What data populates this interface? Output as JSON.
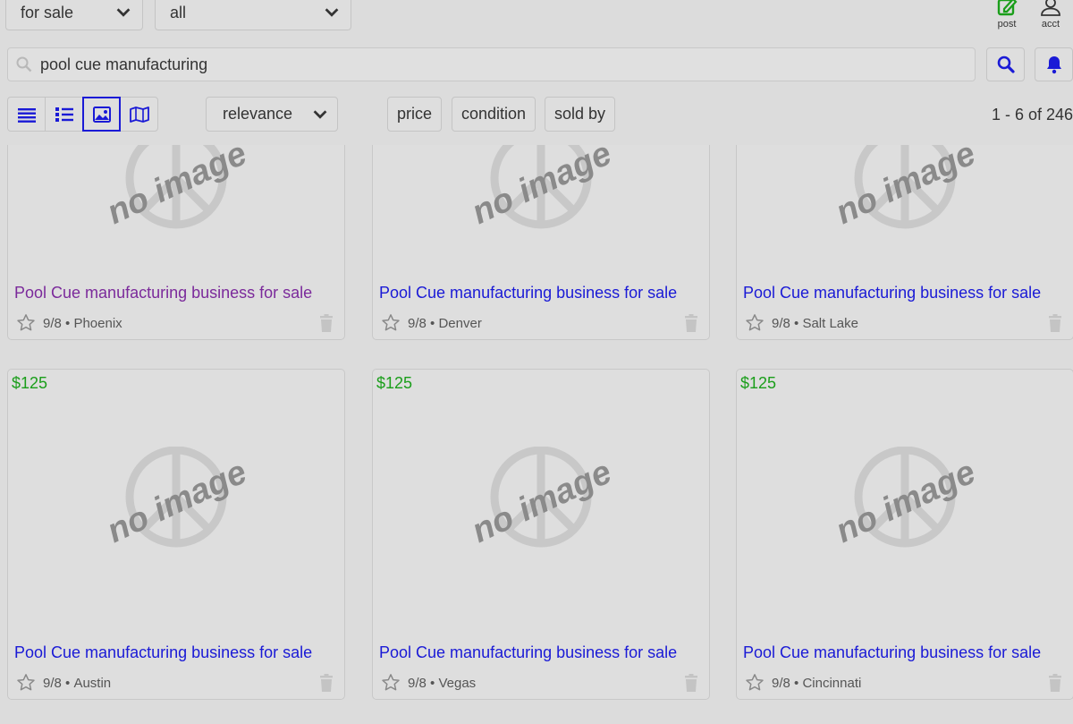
{
  "filters": {
    "category": "for sale",
    "scope": "all"
  },
  "actions": {
    "post": "post",
    "acct": "acct"
  },
  "search": {
    "query": "pool cue manufacturing"
  },
  "toolbar": {
    "sort": "relevance",
    "price": "price",
    "condition": "condition",
    "sold_by": "sold by",
    "result_count": "1 - 6 of 246"
  },
  "colors": {
    "link": "#1a1ad6",
    "visited": "#7b2a9b",
    "price": "#1a9e1a",
    "post_icon": "#1a9e1a"
  },
  "no_image_text": "no image",
  "listings": [
    {
      "price": "",
      "title": "Pool Cue manufacturing business for sale",
      "date": "9/8",
      "location": "Phoenix",
      "visited": true
    },
    {
      "price": "",
      "title": "Pool Cue manufacturing business for sale",
      "date": "9/8",
      "location": "Denver",
      "visited": false
    },
    {
      "price": "",
      "title": "Pool Cue manufacturing business for sale",
      "date": "9/8",
      "location": "Salt Lake",
      "visited": false
    },
    {
      "price": "$125",
      "title": "Pool Cue manufacturing business for sale",
      "date": "9/8",
      "location": "Austin",
      "visited": false
    },
    {
      "price": "$125",
      "title": "Pool Cue manufacturing business for sale",
      "date": "9/8",
      "location": "Vegas",
      "visited": false
    },
    {
      "price": "$125",
      "title": "Pool Cue manufacturing business for sale",
      "date": "9/8",
      "location": "Cincinnati",
      "visited": false
    }
  ]
}
